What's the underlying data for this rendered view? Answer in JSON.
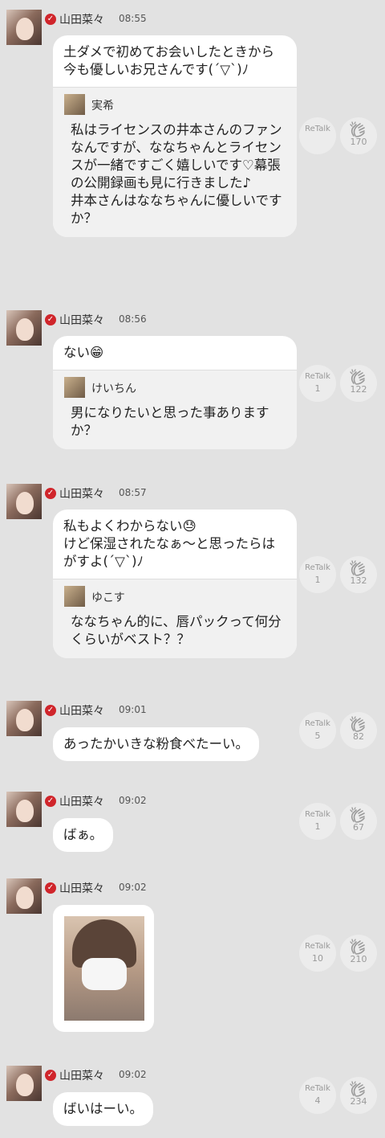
{
  "posts": [
    {
      "name": "山田菜々",
      "time": "08:55",
      "message": "土ダメで初めてお会いしたときから今も優しいお兄さんです(´▽`)ﾉ",
      "quote": {
        "name": "実希",
        "text": "私はライセンスの井本さんのファンなんですが、ななちゃんとライセンスが一緒ですごく嬉しいです♡幕張の公開録画も見に行きました♪\n井本さんはななちゃんに優しいですか？"
      },
      "retalk_label": "ReTalk",
      "retalk_count": "",
      "clap_count": "170"
    },
    {
      "name": "山田菜々",
      "time": "08:56",
      "message": "ない😁",
      "quote": {
        "name": "けいちん",
        "text": "男になりたいと思った事ありますか？"
      },
      "retalk_label": "ReTalk",
      "retalk_count": "1",
      "clap_count": "122"
    },
    {
      "name": "山田菜々",
      "time": "08:57",
      "message": "私もよくわからない😓\nけど保湿されたなぁ～と思ったらはがすよ(´▽`)ﾉ",
      "quote": {
        "name": "ゆこす",
        "text": "ななちゃん的に、唇パックって何分くらいがベスト？？"
      },
      "retalk_label": "ReTalk",
      "retalk_count": "1",
      "clap_count": "132"
    },
    {
      "name": "山田菜々",
      "time": "09:01",
      "message": "あったかいきな粉食べたーい。",
      "retalk_label": "ReTalk",
      "retalk_count": "5",
      "clap_count": "82"
    },
    {
      "name": "山田菜々",
      "time": "09:02",
      "message": "ばぁ。",
      "retalk_label": "ReTalk",
      "retalk_count": "1",
      "clap_count": "67"
    },
    {
      "name": "山田菜々",
      "time": "09:02",
      "message": "",
      "retalk_label": "ReTalk",
      "retalk_count": "10",
      "clap_count": "210"
    },
    {
      "name": "山田菜々",
      "time": "09:02",
      "message": "ばいはーい。",
      "retalk_label": "ReTalk",
      "retalk_count": "4",
      "clap_count": "234"
    }
  ],
  "icons": {
    "verified": "check-badge-icon",
    "clap": "clapping-hands-icon"
  },
  "colors": {
    "background": "#e2e2e2",
    "bubble": "#ffffff",
    "quote_background": "#f1f1f1",
    "verified_badge": "#d0252b",
    "count_text": "#9a9a9a"
  }
}
